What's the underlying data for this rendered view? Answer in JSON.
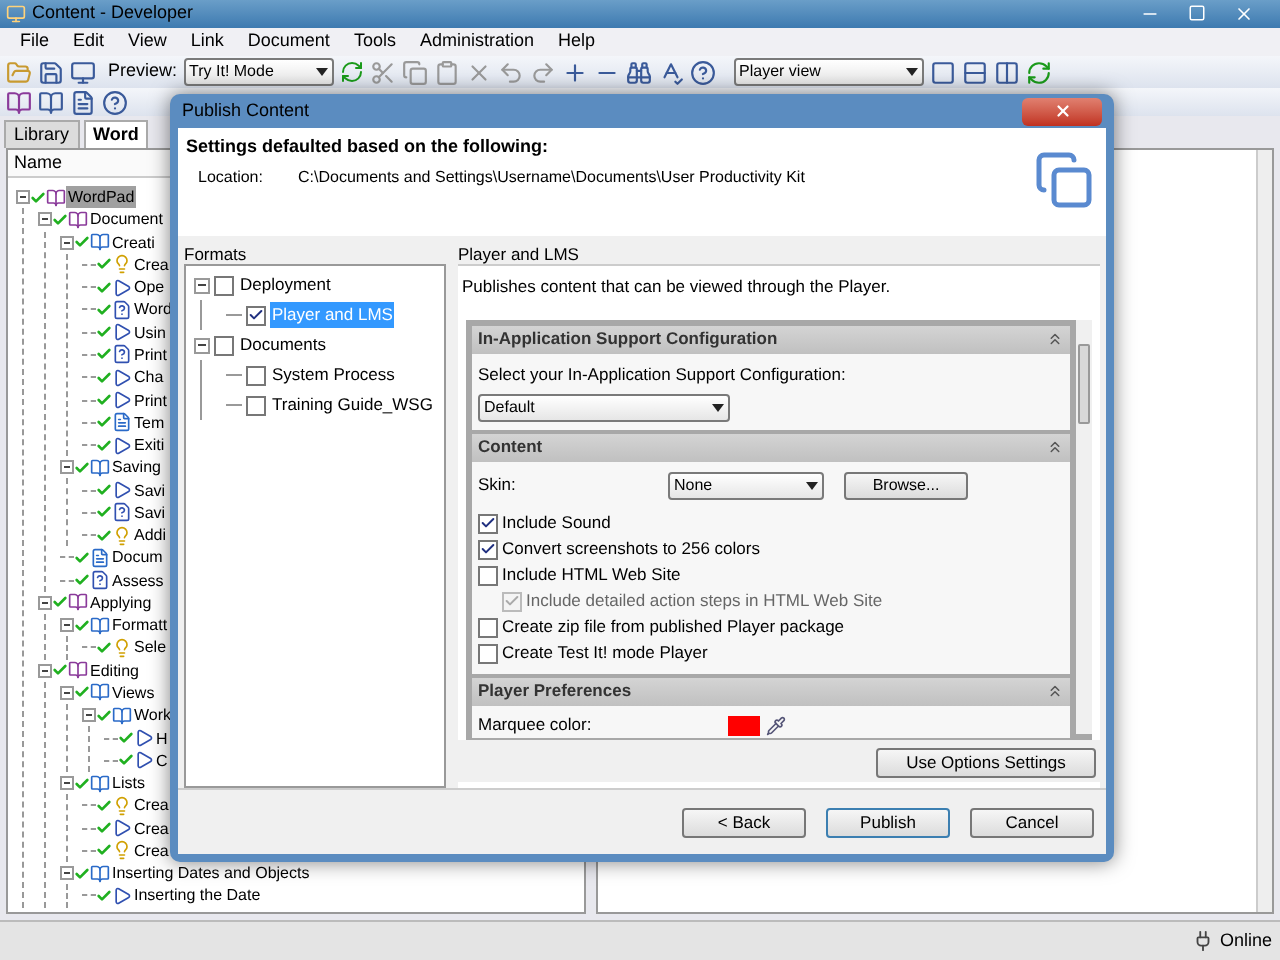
{
  "window": {
    "title": "Content - Developer"
  },
  "menu": [
    "File",
    "Edit",
    "View",
    "Link",
    "Document",
    "Tools",
    "Administration",
    "Help"
  ],
  "toolbar": {
    "preview_label": "Preview:",
    "preview_mode": "Try It! Mode",
    "view_mode": "Player view"
  },
  "tabs": [
    {
      "label": "Library",
      "selected": false
    },
    {
      "label": "Word",
      "selected": true
    }
  ],
  "outline": {
    "column": "Name",
    "items": [
      {
        "label": "WordPad",
        "kind": "module",
        "selected": true,
        "children": [
          {
            "label": "Document",
            "kind": "module",
            "selected": false,
            "children": [
              {
                "label": "Creati",
                "kind": "section",
                "selected": false,
                "children": [
                  {
                    "label": "Crea",
                    "kind": "topic",
                    "selected": false
                  },
                  {
                    "label": "Ope",
                    "kind": "task",
                    "selected": false
                  },
                  {
                    "label": "Word",
                    "kind": "question",
                    "selected": false
                  },
                  {
                    "label": "Usin",
                    "kind": "task",
                    "selected": false
                  },
                  {
                    "label": "Print",
                    "kind": "question",
                    "selected": false
                  },
                  {
                    "label": "Cha",
                    "kind": "task",
                    "selected": false
                  },
                  {
                    "label": "Print",
                    "kind": "task",
                    "selected": false
                  },
                  {
                    "label": "Tem",
                    "kind": "document",
                    "selected": false
                  },
                  {
                    "label": "Exiti",
                    "kind": "task",
                    "selected": false
                  }
                ]
              },
              {
                "label": "Saving",
                "kind": "section",
                "selected": false,
                "children": [
                  {
                    "label": "Savi",
                    "kind": "task",
                    "selected": false
                  },
                  {
                    "label": "Savi",
                    "kind": "question",
                    "selected": false
                  },
                  {
                    "label": "Addi",
                    "kind": "topic",
                    "selected": false
                  }
                ]
              },
              {
                "label": "Docum",
                "kind": "document",
                "selected": false
              },
              {
                "label": "Assess",
                "kind": "question",
                "selected": false
              }
            ]
          },
          {
            "label": "Applying",
            "kind": "module",
            "selected": false,
            "children": [
              {
                "label": "Formatt",
                "kind": "section",
                "selected": false,
                "children": [
                  {
                    "label": "Sele",
                    "kind": "topic",
                    "selected": false
                  }
                ]
              }
            ]
          },
          {
            "label": "Editing",
            "kind": "module",
            "selected": false,
            "children": [
              {
                "label": "Views",
                "kind": "section",
                "selected": false,
                "children": [
                  {
                    "label": "Work",
                    "kind": "section",
                    "selected": false,
                    "children": [
                      {
                        "label": "H",
                        "kind": "task",
                        "selected": false
                      },
                      {
                        "label": "C",
                        "kind": "task",
                        "selected": false
                      }
                    ]
                  }
                ]
              },
              {
                "label": "Lists",
                "kind": "section",
                "selected": false,
                "children": [
                  {
                    "label": "Crea",
                    "kind": "topic",
                    "selected": false
                  },
                  {
                    "label": "Crea",
                    "kind": "task",
                    "selected": false
                  },
                  {
                    "label": "Crea",
                    "kind": "topic",
                    "selected": false
                  }
                ]
              },
              {
                "label": "Inserting Dates and Objects",
                "kind": "section",
                "selected": false,
                "children": [
                  {
                    "label": "Inserting the Date",
                    "kind": "task",
                    "selected": false
                  }
                ]
              }
            ]
          }
        ]
      }
    ]
  },
  "dialog": {
    "title": "Publish Content",
    "heading": "Settings defaulted based on the following:",
    "location_label": "Location:",
    "location": "C:\\Documents and Settings\\Username\\Documents\\User Productivity Kit",
    "formats_label": "Formats",
    "formats": [
      {
        "label": "Deployment",
        "checked": false,
        "selected": false,
        "children": [
          {
            "label": "Player and LMS",
            "checked": true,
            "selected": true
          }
        ]
      },
      {
        "label": "Documents",
        "checked": false,
        "selected": false,
        "children": [
          {
            "label": "System Process",
            "checked": false,
            "selected": false
          },
          {
            "label": "Training Guide_WSG",
            "checked": false,
            "selected": false
          }
        ]
      }
    ],
    "format_title": "Player and LMS",
    "format_description": "Publishes content that can be viewed through the Player.",
    "sections": [
      {
        "title": "In-Application Support Configuration",
        "kind": "select",
        "label": "Select your In-Application Support Configuration:",
        "value": "Default"
      },
      {
        "title": "Content",
        "kind": "content",
        "skin_label": "Skin:",
        "skin_value": "None",
        "browse": "Browse...",
        "options": [
          {
            "label": "Include Sound",
            "checked": true,
            "disabled": false
          },
          {
            "label": "Convert screenshots to 256 colors",
            "checked": true,
            "disabled": false
          },
          {
            "label": "Include HTML Web Site",
            "checked": false,
            "disabled": false,
            "children": [
              {
                "label": "Include detailed action steps in HTML Web Site",
                "checked": true,
                "disabled": true
              }
            ]
          },
          {
            "label": "Create zip file from published Player package",
            "checked": false,
            "disabled": false
          },
          {
            "label": "Create Test It! mode Player",
            "checked": false,
            "disabled": false
          }
        ]
      },
      {
        "title": "Player Preferences",
        "kind": "color",
        "label": "Marquee color:",
        "color": "#ff0000"
      }
    ],
    "options_button": "Use Options Settings",
    "buttons": [
      "< Back",
      "Publish",
      "Cancel"
    ]
  },
  "status_bar": {
    "text": "Online"
  }
}
